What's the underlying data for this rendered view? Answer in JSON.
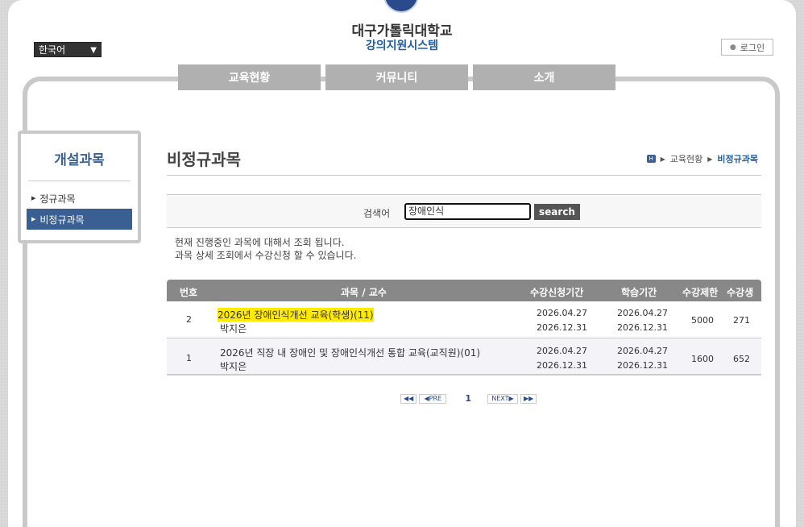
{
  "header": {
    "school_name": "대구가톨릭대학교",
    "system_name": "강의지원시스템",
    "language": "한국어",
    "login_label": "로그인"
  },
  "nav": [
    "교육현황",
    "커뮤니티",
    "소개"
  ],
  "sidebar": {
    "title": "개설과목",
    "items": [
      {
        "label": "정규과목"
      },
      {
        "label": "비정규과목"
      }
    ]
  },
  "page": {
    "title": "비정규과목",
    "breadcrumb": [
      "교육현황",
      "비정규과목"
    ]
  },
  "search": {
    "label": "검색어",
    "value": "장애인식",
    "button": "search"
  },
  "notice": [
    "현재 진행중인 과목에 대해서 조회 됩니다.",
    "과목 상세 조회에서 수강신청 할 수 있습니다."
  ],
  "table": {
    "headers": [
      "번호",
      "과목 / 교수",
      "수강신청기간",
      "학습기간",
      "수강제한",
      "수강생"
    ],
    "rows": [
      {
        "no": "2",
        "title": "2026년 장애인식개선 교육(학생)(11)",
        "professor": "박지은",
        "apply_start": "2026.04.27",
        "apply_end": "2026.12.31",
        "study_start": "2026.04.27",
        "study_end": "2026.12.31",
        "limit": "5000",
        "students": "271"
      },
      {
        "no": "1",
        "title": "2026년 직장 내 장애인 및 장애인식개선 통합 교육(교직원)(01)",
        "professor": "박지은",
        "apply_start": "2026.04.27",
        "apply_end": "2026.12.31",
        "study_start": "2026.04.27",
        "study_end": "2026.12.31",
        "limit": "1600",
        "students": "652"
      }
    ]
  },
  "pagination": {
    "prev": "PRE",
    "next": "NEXT",
    "current": "1"
  }
}
